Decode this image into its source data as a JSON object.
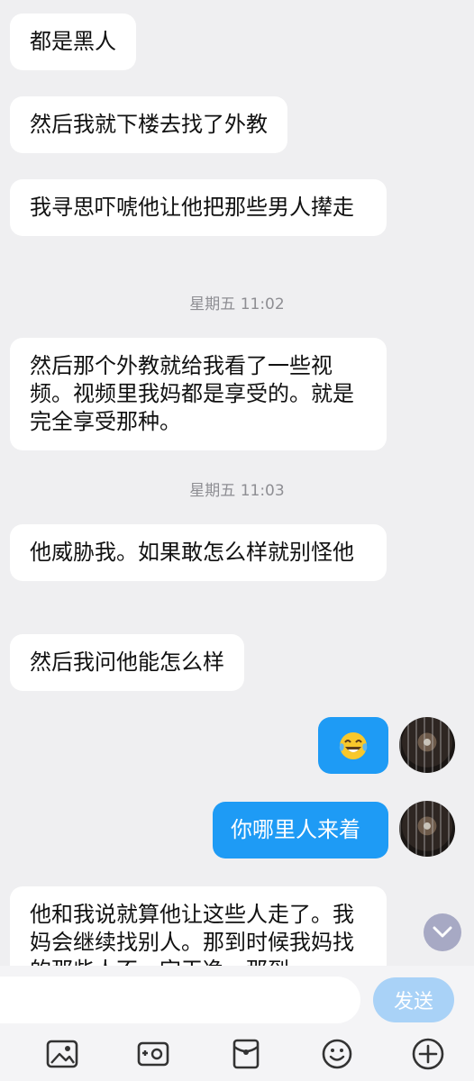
{
  "messages": [
    {
      "side": "left",
      "text": "都是黑人"
    },
    {
      "side": "left",
      "text": "然后我就下楼去找了外教"
    },
    {
      "side": "left",
      "text": "我寻思吓唬他让他把那些男人撵走"
    },
    {
      "side": "time",
      "text": "星期五 11:02"
    },
    {
      "side": "left",
      "text": "然后那个外教就给我看了一些视频。视频里我妈都是享受的。就是完全享受那种。"
    },
    {
      "side": "time",
      "text": "星期五 11:03"
    },
    {
      "side": "left",
      "text": "他威胁我。如果敢怎么样就别怪他"
    },
    {
      "side": "left",
      "text": "然后我问他能怎么样"
    },
    {
      "side": "right",
      "text": "😂",
      "icon": "tears-of-joy-emoji"
    },
    {
      "side": "right",
      "text": "你哪里人来着"
    },
    {
      "side": "left",
      "text": "他和我说就算他让这些人走了。我妈会继续找别人。那到时候我妈找的那些人不一定干净。那到"
    }
  ],
  "input": {
    "placeholder": "",
    "send_label": "发送"
  },
  "toolbar": {
    "icons": [
      "image-icon",
      "camera-icon",
      "red-packet-icon",
      "emoji-icon",
      "plus-icon"
    ]
  },
  "colors": {
    "outgoing_bubble": "#1e9bf5",
    "incoming_bubble": "#ffffff",
    "background": "#efeff1",
    "send_button": "#a9d2f7"
  }
}
